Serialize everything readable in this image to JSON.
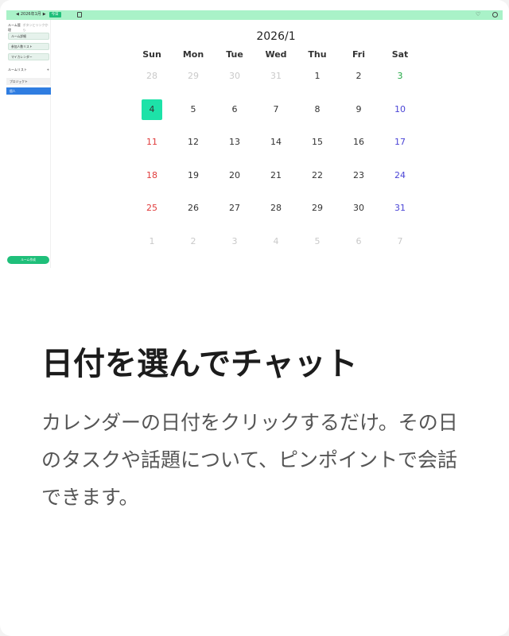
{
  "topbar": {
    "prev_arrow": "◀",
    "month_label": "2026年1月",
    "next_arrow": "▶",
    "today_label": "今日"
  },
  "sidebar": {
    "header_title": "ルーム管理",
    "header_sub": "ボタンとリンクから",
    "buttons": [
      "ルーム詳細",
      "参加人数リスト",
      "マイカレンダー"
    ],
    "section_title": "ルームリスト",
    "section_action": "+",
    "project_label": "プロジェクト",
    "selected_label": "個人",
    "create_label": "ルーム作成"
  },
  "calendar": {
    "title": "2026/1",
    "weekdays": [
      "Sun",
      "Mon",
      "Tue",
      "Wed",
      "Thu",
      "Fri",
      "Sat"
    ],
    "days": [
      "28",
      "29",
      "30",
      "31",
      "1",
      "2",
      "3",
      "4",
      "5",
      "6",
      "7",
      "8",
      "9",
      "10",
      "11",
      "12",
      "13",
      "14",
      "15",
      "16",
      "17",
      "18",
      "19",
      "20",
      "21",
      "22",
      "23",
      "24",
      "25",
      "26",
      "27",
      "28",
      "29",
      "30",
      "31",
      "1",
      "2",
      "3",
      "4",
      "5",
      "6",
      "7"
    ],
    "today": "4",
    "colors": {
      "today_bg": "#1de2a8",
      "sunday": "#e03b3b",
      "saturday": "#4b45d6",
      "holiday": "#22a845",
      "other_month": "#c9c9c9",
      "topbar": "#a9f2c8",
      "accent": "#1fbf7a",
      "selected": "#2f7de1"
    }
  },
  "content": {
    "heading": "日付を選んでチャット",
    "description": "カレンダーの日付をクリックするだけ。その日のタスクや話題について、ピンポイントで会話できます。"
  }
}
